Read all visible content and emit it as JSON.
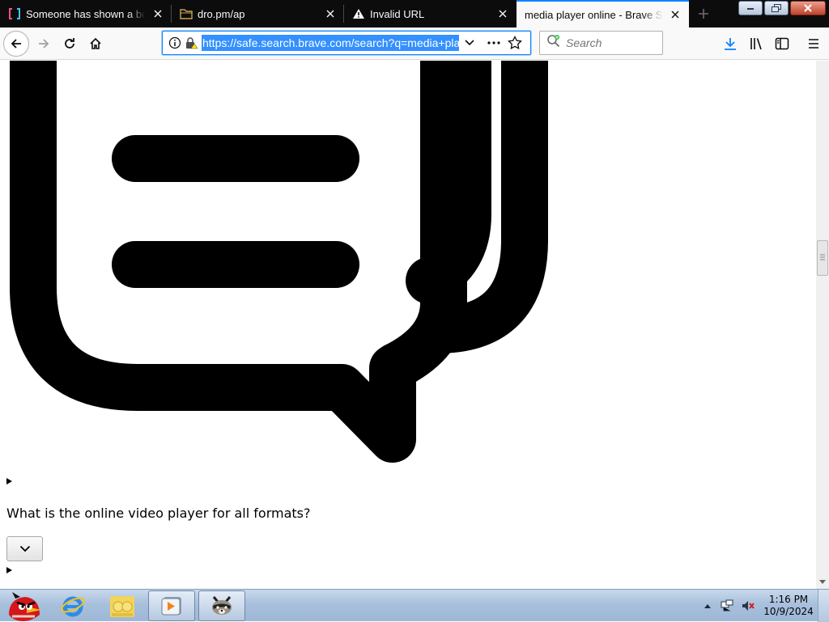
{
  "tabs": [
    {
      "title": "Someone has shown a bold W",
      "icon": "brackets-site-icon",
      "active": false
    },
    {
      "title": "dro.pm/ap",
      "icon": "folder-site-icon",
      "active": false
    },
    {
      "title": "Invalid URL",
      "icon": "warning-icon",
      "active": false
    },
    {
      "title": "media player online - Brave Search",
      "icon": "",
      "active": true
    }
  ],
  "navbar": {
    "url": "https://safe.search.brave.com/search?q=media+player+online",
    "search_placeholder": "Search"
  },
  "content": {
    "faq_question": "What is the online video player for all formats?"
  },
  "taskbar": {
    "apps": [
      "angry-birds-icon",
      "internet-explorer-icon",
      "windows-live-messenger-icon",
      "media-player-icon",
      "raccoon-app-icon"
    ],
    "time": "1:16 PM",
    "date": "10/9/2024"
  },
  "colors": {
    "accent": "#0a84ff",
    "tabstrip_bg": "#0c0c0d",
    "url_selection": "#3390ff",
    "taskbar": "#a8c0dc"
  }
}
